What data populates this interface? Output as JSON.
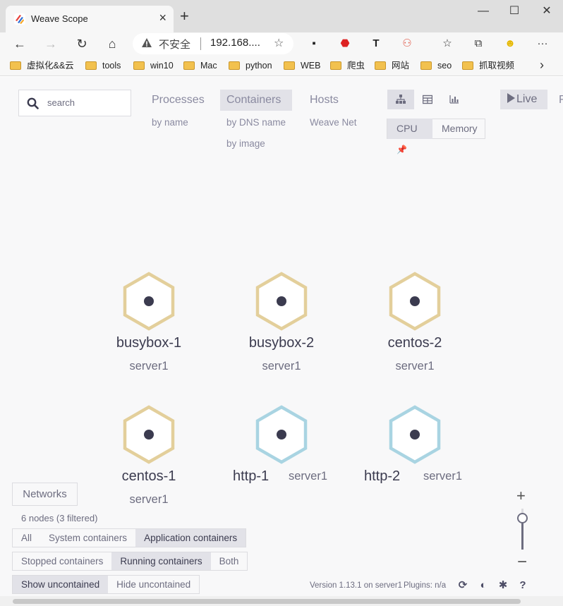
{
  "browser": {
    "tab_title": "Weave Scope",
    "address_insecure": "不安全",
    "address_url": "192.168....",
    "bookmarks": [
      "虚拟化&&云",
      "tools",
      "win10",
      "Mac",
      "python",
      "WEB",
      "爬虫",
      "网站",
      "seo",
      "抓取视频"
    ]
  },
  "search": {
    "placeholder": "search"
  },
  "topologies": [
    {
      "label": "Processes",
      "sub": [
        "by name"
      ]
    },
    {
      "label": "Containers",
      "sub": [
        "by DNS name",
        "by image"
      ]
    },
    {
      "label": "Hosts",
      "sub": [
        "Weave Net"
      ]
    }
  ],
  "metrics": {
    "cpu": "CPU",
    "memory": "Memory"
  },
  "live_label": "Live",
  "pause_partial": "F",
  "nodes": [
    {
      "label": "busybox-1",
      "sub": "server1",
      "color": "#e3cf9b"
    },
    {
      "label": "busybox-2",
      "sub": "server1",
      "color": "#e3cf9b"
    },
    {
      "label": "centos-2",
      "sub": "server1",
      "color": "#e3cf9b"
    },
    {
      "label": "centos-1",
      "sub": "server1",
      "color": "#e3cf9b"
    },
    {
      "label": "http-1",
      "sub": "server1",
      "color": "#a9d4e2"
    },
    {
      "label": "http-2",
      "sub": "server1",
      "color": "#a9d4e2"
    }
  ],
  "networks_label": "Networks",
  "node_count": "6 nodes (3 filtered)",
  "filters": {
    "row1": [
      "All",
      "System containers",
      "Application containers"
    ],
    "row2": [
      "Stopped containers",
      "Running containers",
      "Both"
    ],
    "row3": [
      "Show uncontained",
      "Hide uncontained"
    ]
  },
  "zoom": {
    "plus": "+",
    "minus": "−"
  },
  "footer": {
    "version": "Version 1.13.1 on server1",
    "plugins": "Plugins: n/a"
  }
}
